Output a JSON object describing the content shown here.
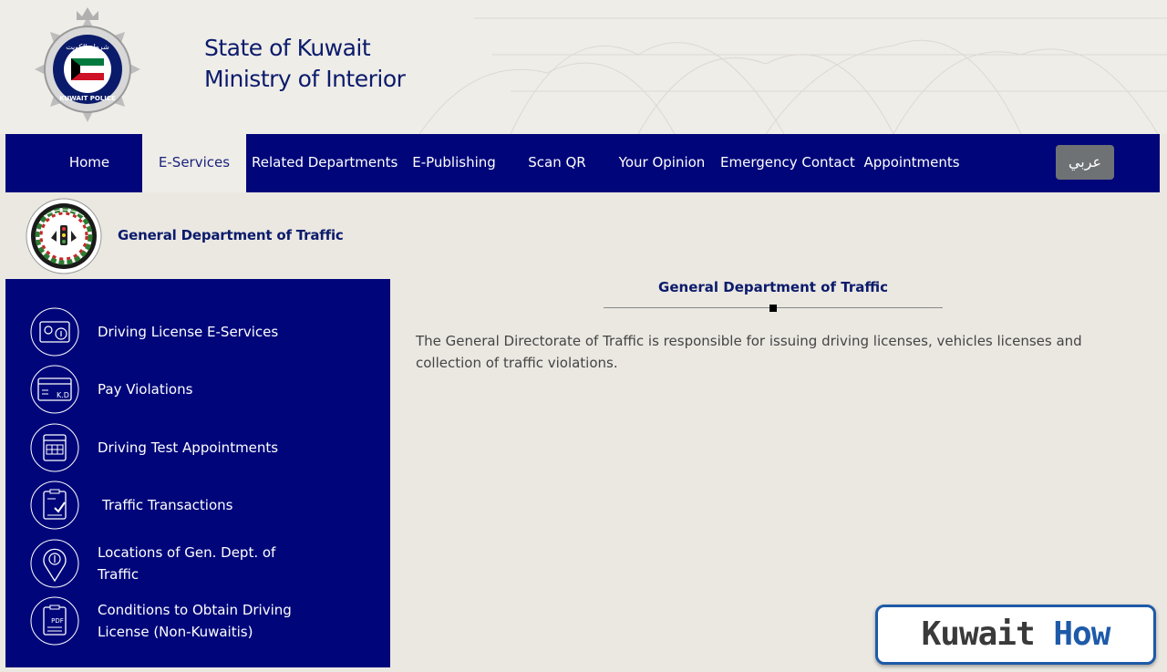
{
  "header": {
    "title_line1": "State of Kuwait",
    "title_line2": "Ministry of Interior",
    "logo_text_arabic": "شرطة الكويت",
    "logo_text_english": "KUWAIT POLICE"
  },
  "nav": {
    "items": [
      {
        "label": "Home",
        "active": false
      },
      {
        "label": "E-Services",
        "active": true
      },
      {
        "label": "Related Departments",
        "active": false
      },
      {
        "label": "E-Publishing",
        "active": false
      },
      {
        "label": "Scan QR",
        "active": false
      },
      {
        "label": "Your Opinion",
        "active": false
      },
      {
        "label": "Emergency Contact",
        "active": false
      },
      {
        "label": "Appointments",
        "active": false
      }
    ],
    "language_button": "عربي"
  },
  "department": {
    "name": "General Department of Traffic"
  },
  "sidebar": {
    "items": [
      {
        "label": "Driving License E-Services",
        "icon": "driving-license-icon"
      },
      {
        "label": "Pay Violations",
        "icon": "payment-card-icon",
        "icon_text": "K.D"
      },
      {
        "label": "Driving Test Appointments",
        "icon": "calendar-icon"
      },
      {
        "label": "Traffic Transactions",
        "icon": "clipboard-check-icon"
      },
      {
        "label": "Locations of Gen. Dept. of Traffic",
        "icon": "location-pin-icon"
      },
      {
        "label": "Conditions to Obtain Driving License (Non-Kuwaitis)",
        "icon": "pdf-document-icon",
        "icon_text": "PDF"
      }
    ]
  },
  "content": {
    "title": "General Department of Traffic",
    "description": "The General Directorate of Traffic is responsible for issuing driving licenses, vehicles licenses and collection of traffic violations."
  },
  "watermark": {
    "text_part1": "Kuwait",
    "text_part2": "How"
  },
  "colors": {
    "nav_background": "#00067a",
    "page_background": "#ebe8e2",
    "title_text": "#0b1b6b",
    "language_button": "#6f7274",
    "watermark_border": "#1e5aa8"
  }
}
